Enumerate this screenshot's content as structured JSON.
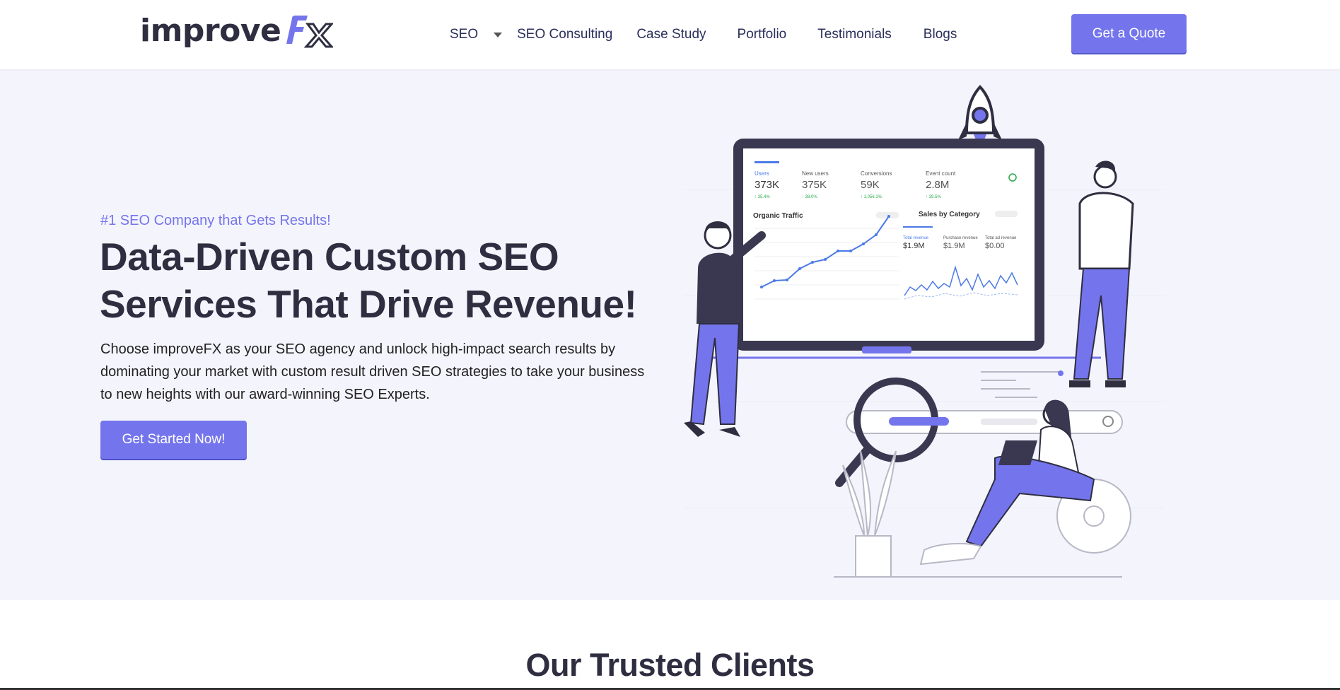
{
  "brand": {
    "logo_text": "improve",
    "logo_suffix": "FX",
    "accent": "#7475ec",
    "dark": "#2f2e41"
  },
  "nav": {
    "items": [
      {
        "label": "SEO",
        "has_dropdown": true
      },
      {
        "label": "SEO Consulting"
      },
      {
        "label": "Case Study"
      },
      {
        "label": "Portfolio"
      },
      {
        "label": "Testimonials"
      },
      {
        "label": "Blogs"
      }
    ],
    "cta": "Get a Quote"
  },
  "hero": {
    "tagline": "#1 SEO Company that Gets Results!",
    "headline_line1": "Data-Driven Custom SEO",
    "headline_line2": "Services That Drive Revenue!",
    "description": "Choose improveFX as your SEO agency and unlock high-impact search results by dominating your market with custom result driven SEO strategies to take your business to new heights with our award-winning SEO Experts.",
    "cta": "Get Started Now!"
  },
  "dashboard": {
    "metrics": [
      {
        "label": "Users",
        "value": "373K",
        "delta": "↑ 35.4%"
      },
      {
        "label": "New users",
        "value": "375K",
        "delta": "↑ 38.0%"
      },
      {
        "label": "Conversions",
        "value": "59K",
        "delta": "↑ 1,056.1%"
      },
      {
        "label": "Event count",
        "value": "2.8M",
        "delta": "↑ 39.5%"
      }
    ],
    "traffic_title": "Organic Traffic",
    "sales_title": "Sales by Category",
    "sales_metrics": [
      {
        "label": "Total revenue",
        "value": "$1.9M"
      },
      {
        "label": "Purchase revenue",
        "value": "$1.9M"
      },
      {
        "label": "Total ad revenue",
        "value": "$0.00"
      }
    ]
  },
  "clients": {
    "title": "Our Trusted Clients"
  }
}
